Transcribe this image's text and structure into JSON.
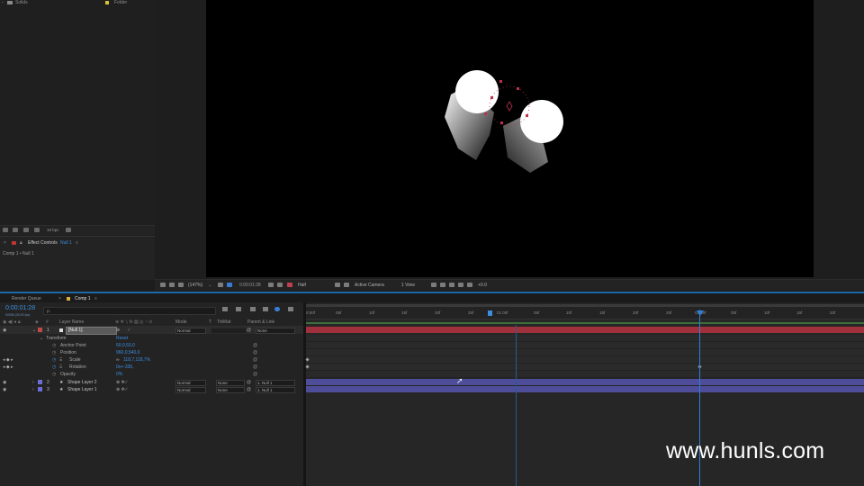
{
  "project": {
    "items": [
      {
        "name": "Solids",
        "type": "Folder"
      }
    ],
    "bpc_label": "16 bpc"
  },
  "effects": {
    "title": "Effect Controls",
    "layer": "Null 1",
    "breadcrumb": "Comp 1 • Null 1"
  },
  "viewer": {
    "zoom": "(147%)",
    "timecode": "0:00:01:28",
    "resolution": "Half",
    "camera": "Active Camera",
    "views": "1 View",
    "exposure": "+0.0"
  },
  "timeline": {
    "tabs": [
      "Render Queue",
      "Comp 1"
    ],
    "current_time": "0:00:01:28",
    "fps_note": "00058 (30.00 fps)",
    "search_placeholder": "ρ.",
    "columns": {
      "name": "Layer Name",
      "mode": "Mode",
      "t": "T",
      "trkmat": "TrkMat",
      "parent": "Parent & Link"
    },
    "layers": [
      {
        "num": "1",
        "name": "[Null 1]",
        "mode": "Normal",
        "trkmat": "",
        "parent": "None",
        "color": "#c34848"
      },
      {
        "num": "2",
        "name": "Shape Layer 2",
        "mode": "Normal",
        "trkmat": "None",
        "parent": "1. Null 1",
        "color": "#6d6dd8"
      },
      {
        "num": "3",
        "name": "Shape Layer 1",
        "mode": "Normal",
        "trkmat": "None",
        "parent": "1. Null 1",
        "color": "#6d6dd8"
      }
    ],
    "transform": {
      "label": "Transform",
      "reset": "Reset",
      "props": [
        {
          "name": "Anchor Point",
          "value": "50,0,50,0"
        },
        {
          "name": "Position",
          "value": "960,0,540,0"
        },
        {
          "name": "Scale",
          "value": "118,7,118,7%"
        },
        {
          "name": "Rotation",
          "value": "0x+-336,"
        },
        {
          "name": "Opacity",
          "value": "0%"
        }
      ]
    },
    "ruler": [
      "0:00f",
      "05f",
      "10f",
      "15f",
      "20f",
      "25f",
      "01:00f",
      "05f",
      "10f",
      "15f",
      "20f",
      "25f",
      "02:00f",
      "05f",
      "10f",
      "15f",
      "20f"
    ]
  },
  "watermark": "www.hunls.com"
}
